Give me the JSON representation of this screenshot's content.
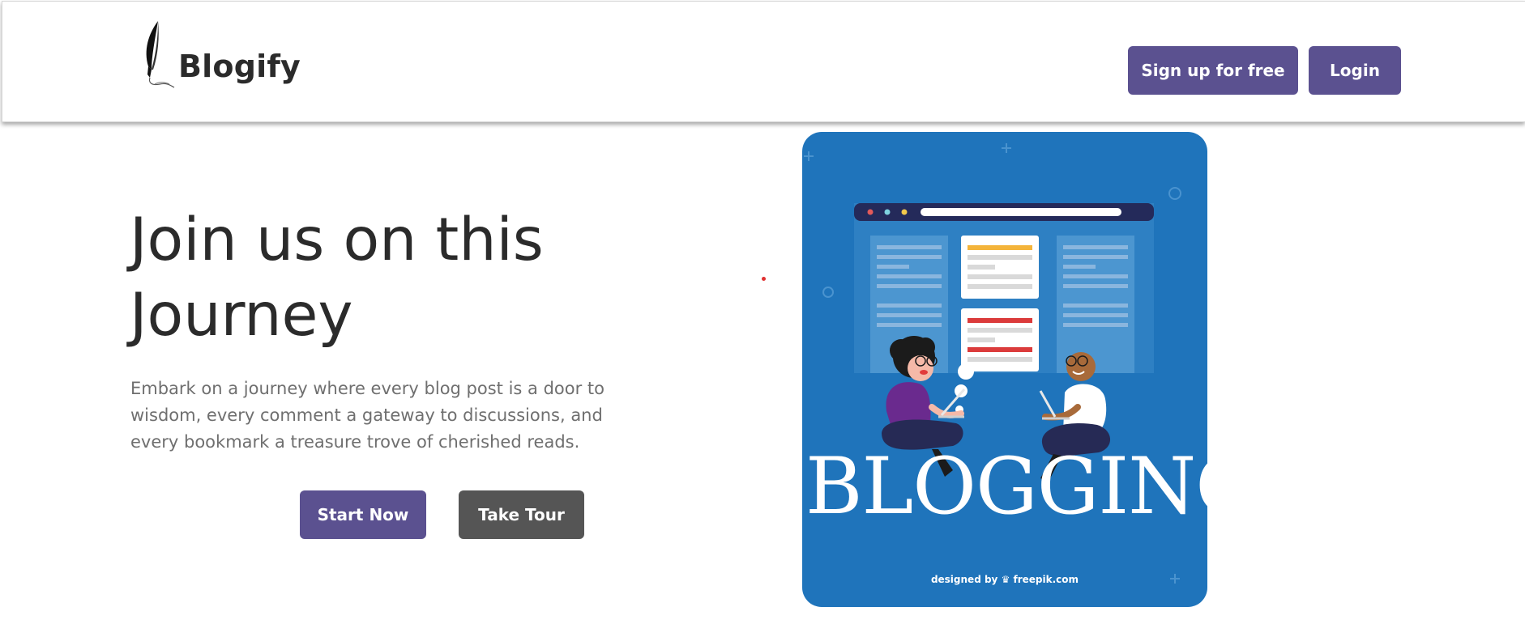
{
  "header": {
    "logo_text": "Blogify",
    "logo_icon": "quill-pen-icon",
    "signup_label": "Sign up for free",
    "login_label": "Login"
  },
  "hero": {
    "title_line1": "Join us on this",
    "title_line2": "Journey",
    "description": "Embark on a journey where every blog post is a door to wisdom, every comment a gateway to discussions, and every bookmark a treasure trove of cherished reads.",
    "start_label": "Start Now",
    "tour_label": "Take Tour"
  },
  "illustration": {
    "word": "BLOGGING",
    "credit_prefix": "designed by",
    "credit_brand": "freepik.com"
  },
  "colors": {
    "primary": "#5b5190",
    "secondary": "#555555",
    "illustration_bg": "#1f74bb"
  }
}
